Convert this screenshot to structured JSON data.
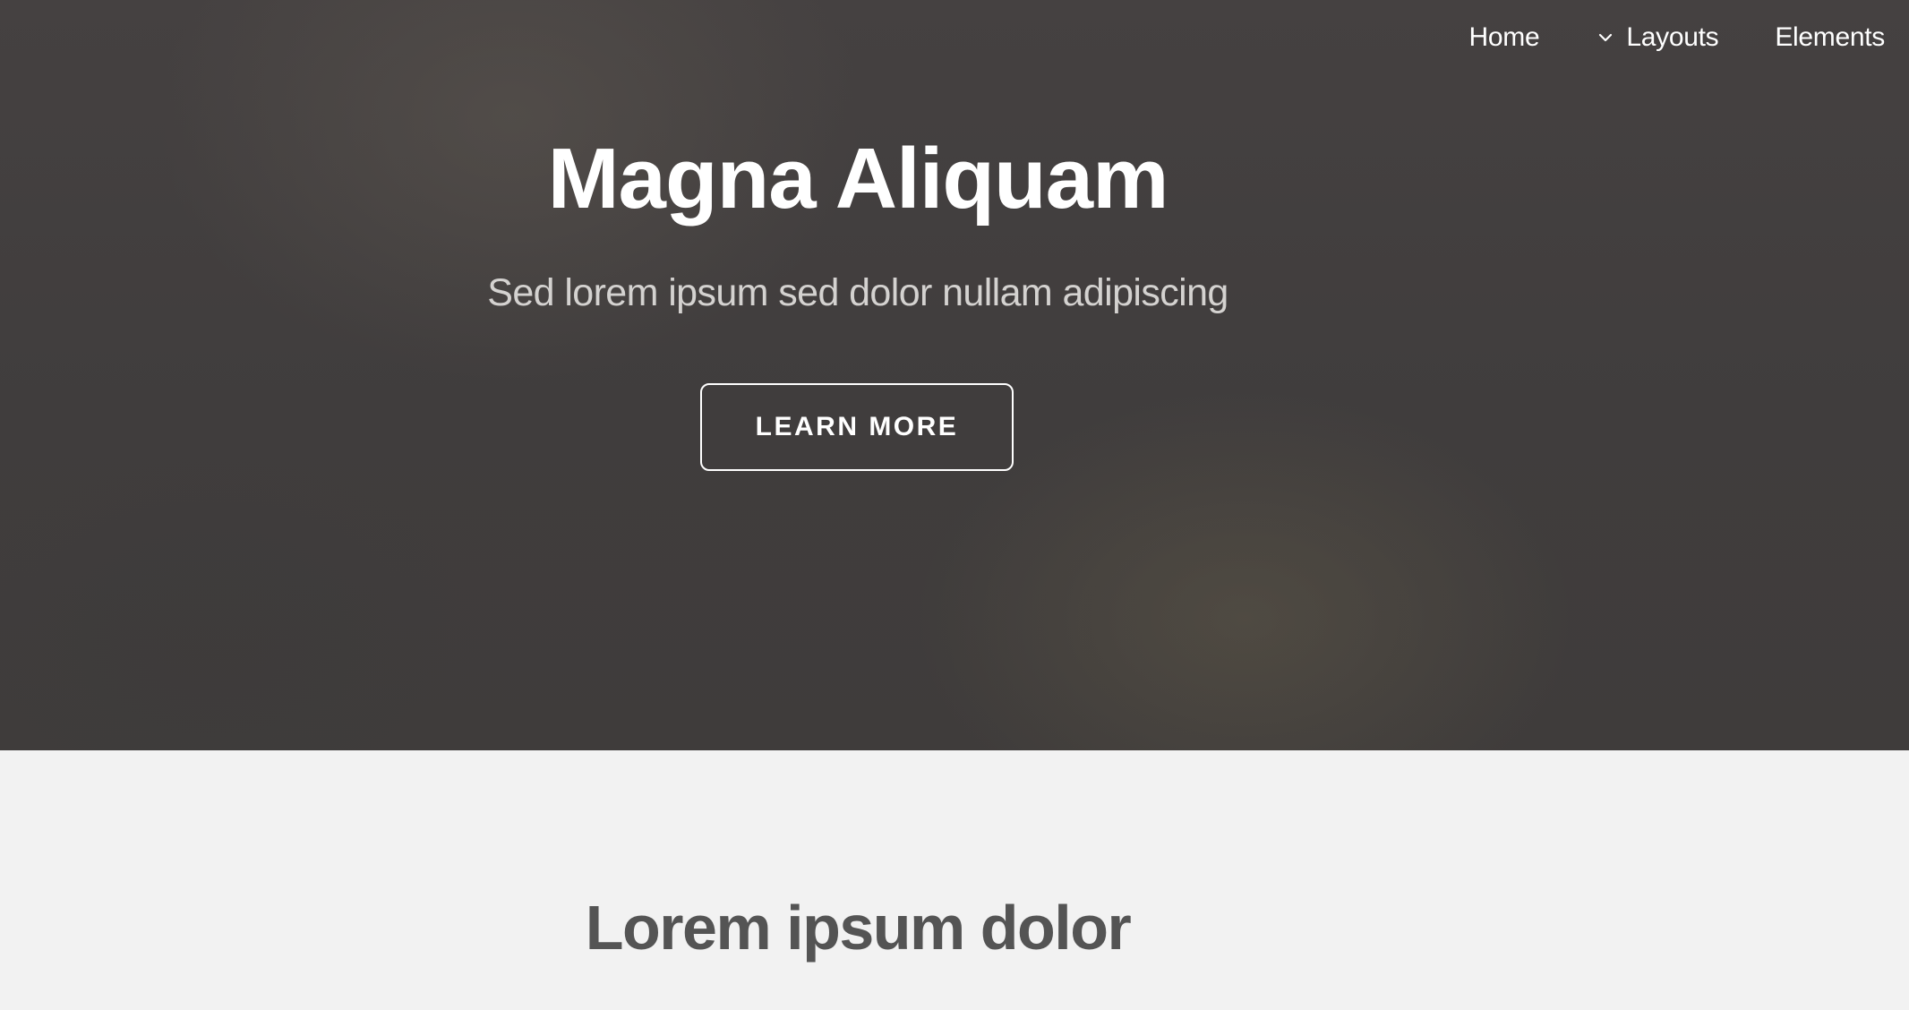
{
  "nav": {
    "items": [
      {
        "label": "Home",
        "icon": null
      },
      {
        "label": "Layouts",
        "icon": "chevron-down-icon"
      },
      {
        "label": "Elements",
        "icon": null
      }
    ]
  },
  "hero": {
    "title": "Magna Aliquam",
    "subtitle": "Sed lorem ipsum sed dolor nullam adipiscing",
    "button_label": "LEARN MORE"
  },
  "section": {
    "title": "Lorem ipsum dolor"
  },
  "colors": {
    "hero_background": "#423f3f",
    "page_background": "#f2f2f2",
    "heading_text": "#545454",
    "hero_text": "#ffffff",
    "hero_subtitle": "#d4d2d0"
  }
}
